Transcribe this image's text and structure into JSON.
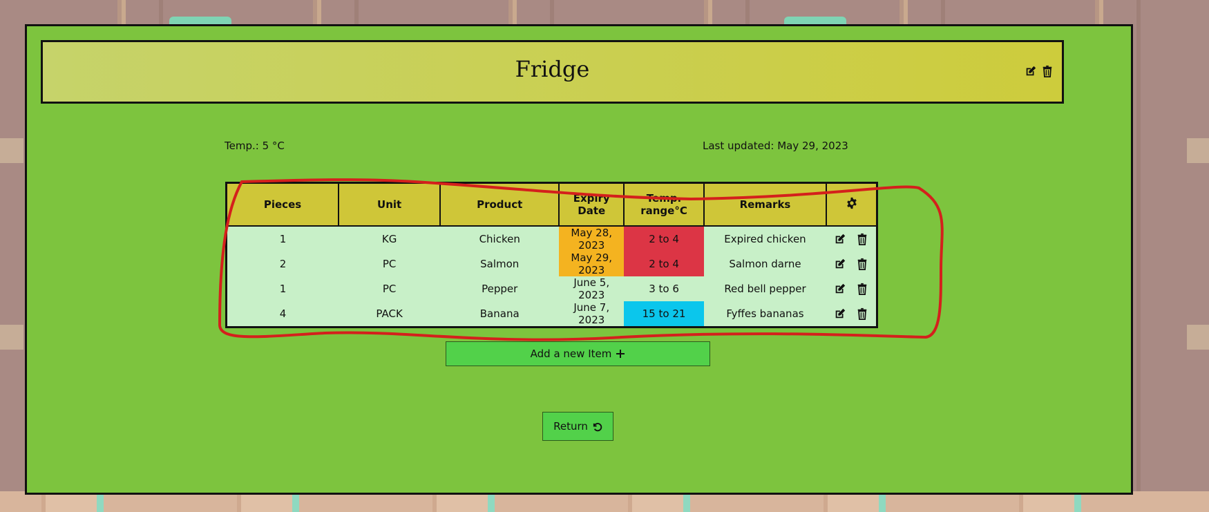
{
  "page": {
    "title": "Fridge"
  },
  "info": {
    "temperature": "Temp.: 5 °C",
    "last_updated": "Last updated: May 29, 2023"
  },
  "table": {
    "headers": [
      "Pieces",
      "Unit",
      "Product",
      "Expiry Date",
      "Temp. range°C",
      "Remarks"
    ],
    "settings_icon": "gear-icon",
    "rows": [
      {
        "pieces": "1",
        "unit": "KG",
        "product": "Chicken",
        "expiry": "May 28, 2023",
        "temp_range": "2 to 4",
        "remarks": "Expired chicken",
        "expiry_status": "warning",
        "temp_status": "danger"
      },
      {
        "pieces": "2",
        "unit": "PC",
        "product": "Salmon",
        "expiry": "May 29, 2023",
        "temp_range": "2 to 4",
        "remarks": "Salmon darne",
        "expiry_status": "warning",
        "temp_status": "danger"
      },
      {
        "pieces": "1",
        "unit": "PC",
        "product": "Pepper",
        "expiry": "June 5, 2023",
        "temp_range": "3 to 6",
        "remarks": "Red bell pepper",
        "expiry_status": "normal",
        "temp_status": "normal"
      },
      {
        "pieces": "4",
        "unit": "PACK",
        "product": "Banana",
        "expiry": "June 7, 2023",
        "temp_range": "15 to 21",
        "remarks": "Fyffes bananas",
        "expiry_status": "normal",
        "temp_status": "info"
      }
    ]
  },
  "buttons": {
    "add_item": "Add a new Item",
    "return": "Return"
  },
  "colors": {
    "card_bg": "#7dc43e",
    "header_bg": "#cfc638",
    "row_bg": "#c8f0c8",
    "warning": "#f4b320",
    "danger": "#dc3545",
    "info": "#0bc6ec",
    "button": "#52d14a",
    "annotation": "#d4201c"
  }
}
